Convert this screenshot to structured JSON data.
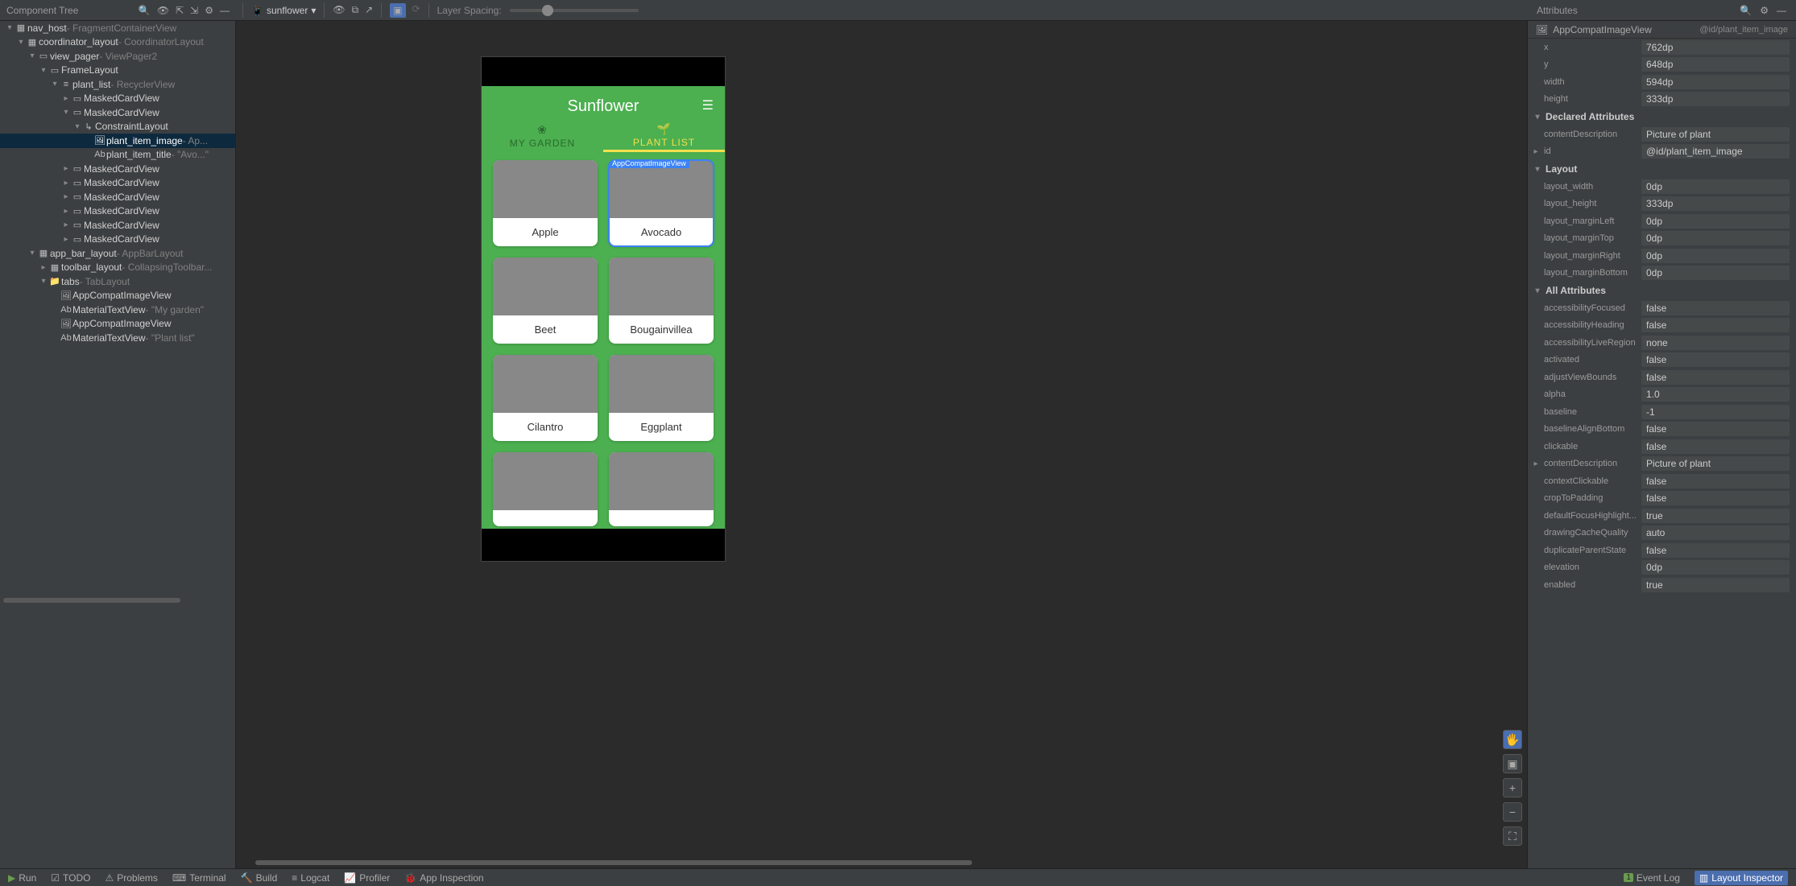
{
  "panels": {
    "tree_title": "Component Tree",
    "attrs_title": "Attributes",
    "layer_spacing": "Layer Spacing:"
  },
  "process": {
    "name": "sunflower"
  },
  "tree": [
    {
      "d": 0,
      "exp": true,
      "icon": "▦",
      "name": "nav_host",
      "sub": " - FragmentContainerView"
    },
    {
      "d": 1,
      "exp": true,
      "icon": "▦",
      "name": "coordinator_layout",
      "sub": " - CoordinatorLayout"
    },
    {
      "d": 2,
      "exp": true,
      "icon": "▭",
      "name": "view_pager",
      "sub": " - ViewPager2"
    },
    {
      "d": 3,
      "exp": true,
      "icon": "▭",
      "name": "FrameLayout",
      "sub": ""
    },
    {
      "d": 4,
      "exp": true,
      "icon": "≡",
      "name": "plant_list",
      "sub": " - RecyclerView"
    },
    {
      "d": 5,
      "exp": false,
      "icon": "▭",
      "name": "MaskedCardView",
      "sub": ""
    },
    {
      "d": 5,
      "exp": true,
      "icon": "▭",
      "name": "MaskedCardView",
      "sub": ""
    },
    {
      "d": 6,
      "exp": true,
      "icon": "↳",
      "name": "ConstraintLayout",
      "sub": ""
    },
    {
      "d": 7,
      "exp": null,
      "icon": "🖼",
      "name": "plant_item_image",
      "sub": " - Ap...",
      "sel": true
    },
    {
      "d": 7,
      "exp": null,
      "icon": "Ab",
      "name": "plant_item_title",
      "sub": " - \"Avo...\""
    },
    {
      "d": 5,
      "exp": false,
      "icon": "▭",
      "name": "MaskedCardView",
      "sub": ""
    },
    {
      "d": 5,
      "exp": false,
      "icon": "▭",
      "name": "MaskedCardView",
      "sub": ""
    },
    {
      "d": 5,
      "exp": false,
      "icon": "▭",
      "name": "MaskedCardView",
      "sub": ""
    },
    {
      "d": 5,
      "exp": false,
      "icon": "▭",
      "name": "MaskedCardView",
      "sub": ""
    },
    {
      "d": 5,
      "exp": false,
      "icon": "▭",
      "name": "MaskedCardView",
      "sub": ""
    },
    {
      "d": 5,
      "exp": false,
      "icon": "▭",
      "name": "MaskedCardView",
      "sub": ""
    },
    {
      "d": 2,
      "exp": true,
      "icon": "▦",
      "name": "app_bar_layout",
      "sub": " - AppBarLayout"
    },
    {
      "d": 3,
      "exp": false,
      "icon": "▦",
      "name": "toolbar_layout",
      "sub": " - CollapsingToolbar..."
    },
    {
      "d": 3,
      "exp": true,
      "icon": "📁",
      "name": "tabs",
      "sub": " - TabLayout"
    },
    {
      "d": 4,
      "exp": null,
      "icon": "🖼",
      "name": "AppCompatImageView",
      "sub": ""
    },
    {
      "d": 4,
      "exp": null,
      "icon": "Ab",
      "name": "MaterialTextView",
      "sub": " - \"My garden\""
    },
    {
      "d": 4,
      "exp": null,
      "icon": "🖼",
      "name": "AppCompatImageView",
      "sub": ""
    },
    {
      "d": 4,
      "exp": null,
      "icon": "Ab",
      "name": "MaterialTextView",
      "sub": " - \"Plant list\""
    }
  ],
  "device": {
    "title": "Sunflower",
    "selected_overlay": "AppCompatImageView",
    "tabs": [
      {
        "label": "MY GARDEN",
        "active": false
      },
      {
        "label": "PLANT LIST",
        "active": true
      }
    ],
    "plants": [
      {
        "label": "Apple",
        "cls": "pl-apple"
      },
      {
        "label": "Avocado",
        "cls": "pl-avocado",
        "selected": true
      },
      {
        "label": "Beet",
        "cls": "pl-beet"
      },
      {
        "label": "Bougainvillea",
        "cls": "pl-boug"
      },
      {
        "label": "Cilantro",
        "cls": "pl-cilantro"
      },
      {
        "label": "Eggplant",
        "cls": "pl-eggplant"
      },
      {
        "label": "",
        "cls": "pl-grape",
        "cut": true
      },
      {
        "label": "",
        "cls": "pl-hibiscus",
        "cut": true
      }
    ]
  },
  "attrs": {
    "class": "AppCompatImageView",
    "id_ref": "@id/plant_item_image",
    "basic": [
      {
        "k": "x",
        "v": "762dp"
      },
      {
        "k": "y",
        "v": "648dp"
      },
      {
        "k": "width",
        "v": "594dp"
      },
      {
        "k": "height",
        "v": "333dp"
      }
    ],
    "declared_title": "Declared Attributes",
    "declared": [
      {
        "k": "contentDescription",
        "v": "Picture of plant"
      },
      {
        "k": "id",
        "v": "@id/plant_item_image",
        "chev": true
      }
    ],
    "layout_title": "Layout",
    "layout": [
      {
        "k": "layout_width",
        "v": "0dp"
      },
      {
        "k": "layout_height",
        "v": "333dp"
      },
      {
        "k": "layout_marginLeft",
        "v": "0dp"
      },
      {
        "k": "layout_marginTop",
        "v": "0dp"
      },
      {
        "k": "layout_marginRight",
        "v": "0dp"
      },
      {
        "k": "layout_marginBottom",
        "v": "0dp"
      }
    ],
    "all_title": "All Attributes",
    "all": [
      {
        "k": "accessibilityFocused",
        "v": "false"
      },
      {
        "k": "accessibilityHeading",
        "v": "false"
      },
      {
        "k": "accessibilityLiveRegion",
        "v": "none"
      },
      {
        "k": "activated",
        "v": "false"
      },
      {
        "k": "adjustViewBounds",
        "v": "false"
      },
      {
        "k": "alpha",
        "v": "1.0"
      },
      {
        "k": "baseline",
        "v": "-1"
      },
      {
        "k": "baselineAlignBottom",
        "v": "false"
      },
      {
        "k": "clickable",
        "v": "false"
      },
      {
        "k": "contentDescription",
        "v": "Picture of plant",
        "chev": true
      },
      {
        "k": "contextClickable",
        "v": "false"
      },
      {
        "k": "cropToPadding",
        "v": "false"
      },
      {
        "k": "defaultFocusHighlight...",
        "v": "true"
      },
      {
        "k": "drawingCacheQuality",
        "v": "auto"
      },
      {
        "k": "duplicateParentState",
        "v": "false"
      },
      {
        "k": "elevation",
        "v": "0dp"
      },
      {
        "k": "enabled",
        "v": "true"
      }
    ]
  },
  "bottom": {
    "items": [
      "Run",
      "TODO",
      "Problems",
      "Terminal",
      "Build",
      "Logcat",
      "Profiler",
      "App Inspection"
    ],
    "event_log": "Event Log",
    "layout_inspector": "Layout Inspector",
    "event_count": "1"
  }
}
